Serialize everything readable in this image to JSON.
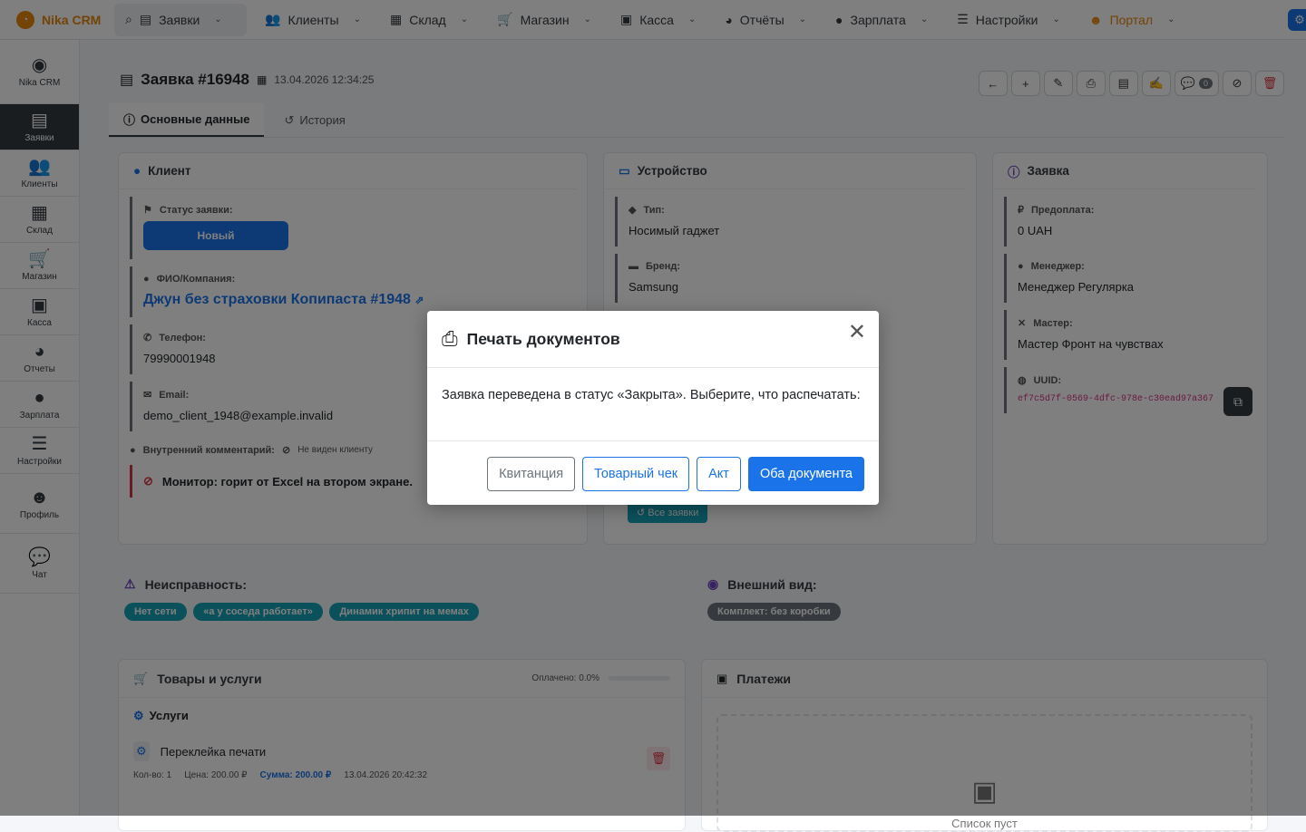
{
  "brand": {
    "name": "Nika CRM"
  },
  "nav": {
    "items": [
      {
        "label": "Заявки",
        "icon": "file-icon"
      },
      {
        "label": "Клиенты",
        "icon": "users-icon"
      },
      {
        "label": "Склад",
        "icon": "boxes-icon"
      },
      {
        "label": "Магазин",
        "icon": "cart-icon"
      },
      {
        "label": "Касса",
        "icon": "cash-register-icon"
      },
      {
        "label": "Отчёты",
        "icon": "pie-chart-icon"
      },
      {
        "label": "Зарплата",
        "icon": "user-tie-icon"
      },
      {
        "label": "Настройки",
        "icon": "sliders-icon"
      },
      {
        "label": "Портал",
        "icon": "user-circle-icon"
      }
    ]
  },
  "sidebar": {
    "items": [
      {
        "label": "Nika CRM"
      },
      {
        "label": "Заявки"
      },
      {
        "label": "Клиенты"
      },
      {
        "label": "Склад"
      },
      {
        "label": "Магазин"
      },
      {
        "label": "Касса"
      },
      {
        "label": "Отчеты"
      },
      {
        "label": "Зарплата"
      },
      {
        "label": "Настройки"
      },
      {
        "label": "Профиль"
      },
      {
        "label": "Чат"
      }
    ]
  },
  "order": {
    "title": "Заявка #16948",
    "date": "13.04.2026 12:34:25",
    "comments_count": "0"
  },
  "tabs": {
    "main": "Основные данные",
    "history": "История"
  },
  "client_card": {
    "title": "Клиент",
    "status_label": "Статус заявки:",
    "status_value": "Новый",
    "name_label": "ФИО/Компания:",
    "name_value": "Джун без страховки Копипаста #1948",
    "phone_label": "Телефон:",
    "phone_value": "79990001948",
    "email_label": "Email:",
    "email_value": "demo_client_1948@example.invalid",
    "comment_label": "Внутренний комментарий:",
    "comment_hint": "Не виден клиенту",
    "comment_value": "Монитор: горит от Excel на втором экране."
  },
  "device_card": {
    "title": "Устройство",
    "type_label": "Тип:",
    "type_value": "Носимый гаджет",
    "brand_label": "Бренд:",
    "brand_value": "Samsung",
    "all_orders": "Все заявки"
  },
  "order_card": {
    "title": "Заявка",
    "prepay_label": "Предоплата:",
    "prepay_value": "0 UAH",
    "manager_label": "Менеджер:",
    "manager_value": "Менеджер Регулярка",
    "master_label": "Мастер:",
    "master_value": "Мастер Фронт на чувствах",
    "uuid_label": "UUID:",
    "uuid_value": "ef7c5d7f-0569-4dfc-978e-c30ead97a367"
  },
  "faults": {
    "title": "Неисправность:",
    "tags": [
      "Нет сети",
      "«а у соседа работает»",
      "Динамик хрипит на мемах"
    ]
  },
  "appearance": {
    "title": "Внешний вид:",
    "tags": [
      "Комплект: без коробки"
    ]
  },
  "goods": {
    "title": "Товары и услуги",
    "paid": "Оплачено: 0.0%",
    "paid_fraction": 0.0,
    "services_label": "Услуги",
    "item_name": "Переклейка печати",
    "qty": "Кол-во: 1",
    "price": "Цена: 200.00 ₽",
    "sum": "Сумма: 200.00 ₽",
    "item_date": "13.04.2026 20:42:32"
  },
  "payments": {
    "title": "Платежи",
    "empty": "Список пуст"
  },
  "modal": {
    "title": "Печать документов",
    "body": "Заявка переведена в статус «Закрыта». Выберите, что распечатать:",
    "buttons": {
      "receipt": "Квитанция",
      "sales_check": "Товарный чек",
      "act": "Акт",
      "both": "Оба документа"
    }
  },
  "colors": {
    "primary": "#1a73e8",
    "brand": "#e8860c",
    "danger": "#dc3545",
    "success": "#28a745",
    "tag": "#17a2b8"
  }
}
